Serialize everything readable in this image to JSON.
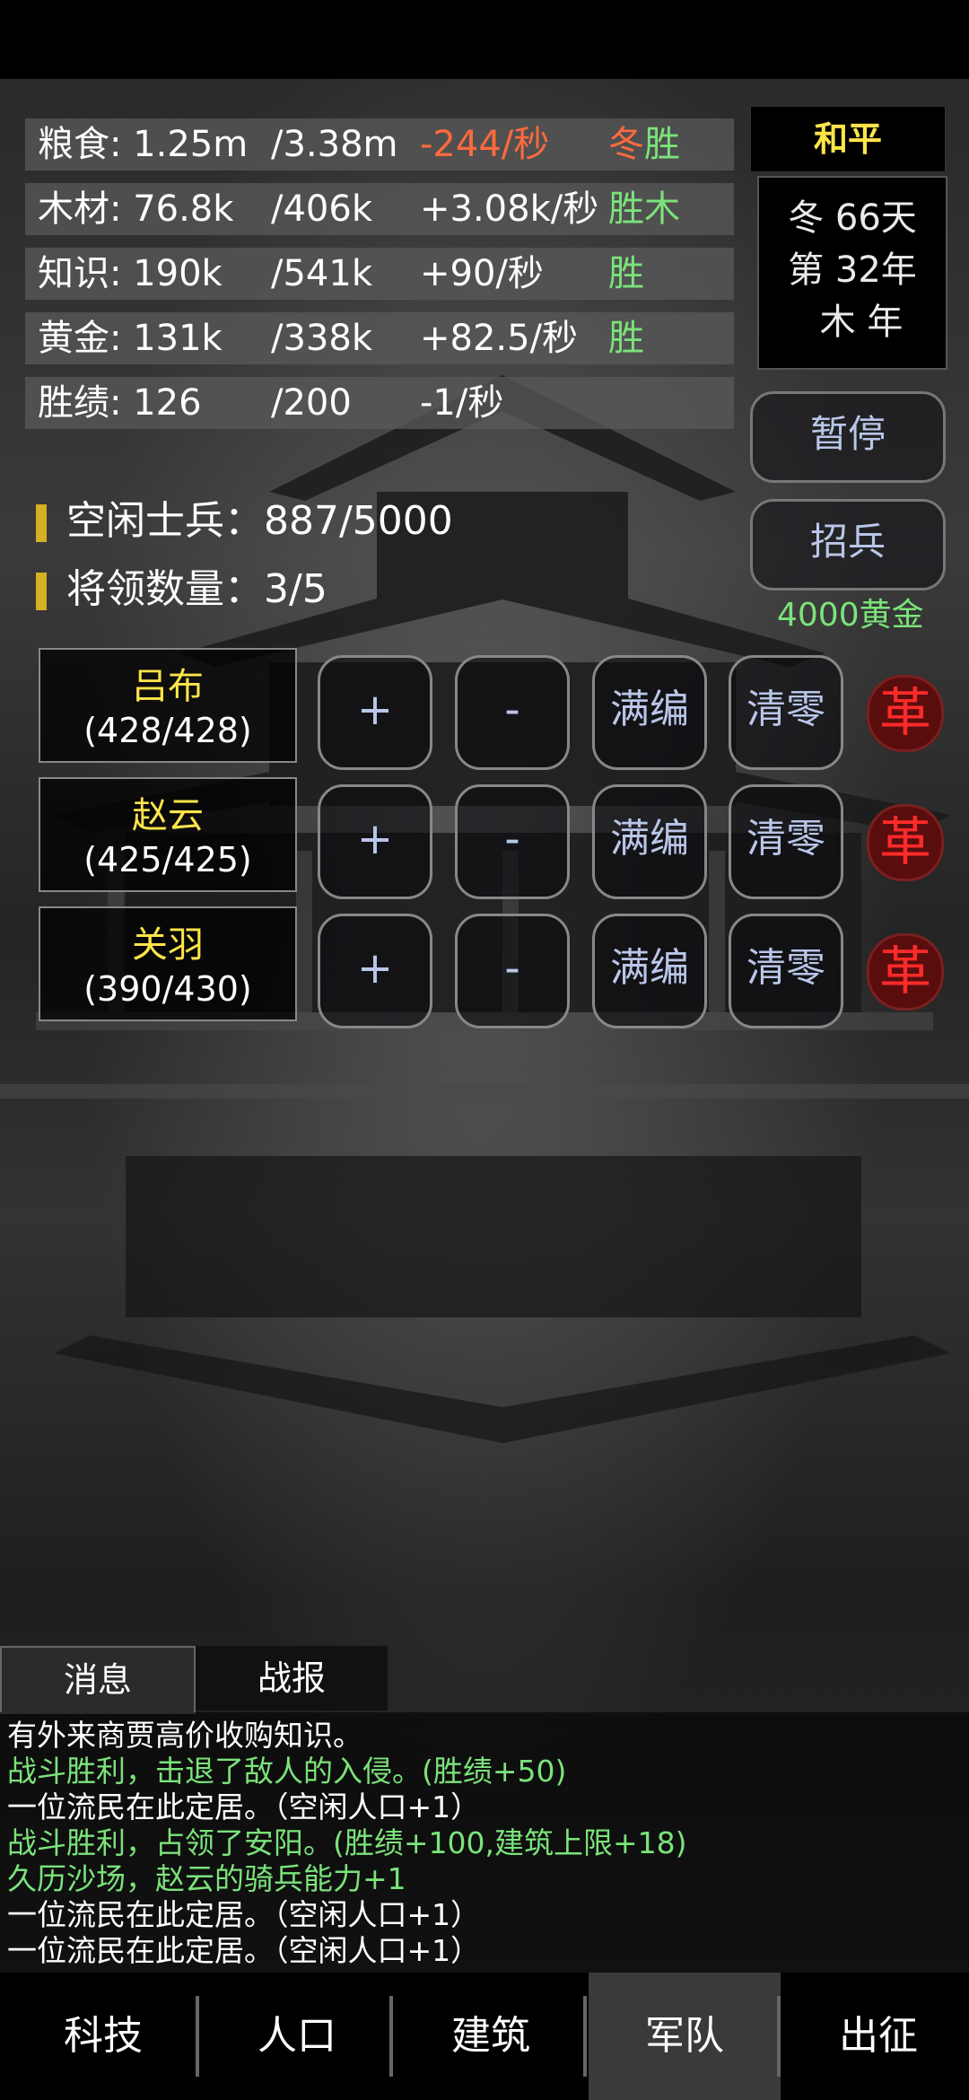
{
  "resources": [
    {
      "name": "粮食: 1.25m",
      "cap": "/3.38m",
      "rate": "-244/秒",
      "tag": "冬胜",
      "rate_color": "#ff6a3d",
      "tag_color": "#ff6a3d",
      "tag2": "",
      "tag2_color": "#7be37b"
    },
    {
      "name": "木材: 76.8k",
      "cap": "/406k",
      "rate": "+3.08k/秒",
      "tag": "胜木",
      "rate_color": "#ffffff",
      "tag_color": "#7be37b"
    },
    {
      "name": "知识: 190k",
      "cap": "/541k",
      "rate": "+90/秒",
      "tag": "胜",
      "rate_color": "#ffffff",
      "tag_color": "#7be37b"
    },
    {
      "name": "黄金: 131k",
      "cap": "/338k",
      "rate": "+82.5/秒",
      "tag": "胜",
      "rate_color": "#ffffff",
      "tag_color": "#7be37b"
    },
    {
      "name": "胜绩: 126",
      "cap": "/200",
      "rate": "-1/秒",
      "tag": "",
      "rate_color": "#ffffff",
      "tag_color": "#7be37b"
    }
  ],
  "status": {
    "peace": "和平",
    "date_line1": "冬 66天",
    "date_line2": "第 32年",
    "date_line3": "木 年"
  },
  "buttons": {
    "pause": "暂停",
    "recruit": "招兵",
    "recruit_cost": "4000黄金"
  },
  "army": {
    "idle_soldiers": "空闲士兵：887/5000",
    "general_count": "将领数量：3/5"
  },
  "generals": [
    {
      "name": "吕布",
      "troops": "(428/428)"
    },
    {
      "name": "赵云",
      "troops": "(425/425)"
    },
    {
      "name": "关羽",
      "troops": "(390/430)"
    }
  ],
  "general_controls": {
    "plus": "+",
    "minus": "-",
    "fill": "满编",
    "clear": "清零",
    "dismiss": "革"
  },
  "log_tabs": {
    "messages": "消息",
    "battle": "战报"
  },
  "log": [
    {
      "text": "有外来商贾高价收购知识。",
      "color": "#ffffff"
    },
    {
      "text": "战斗胜利，击退了敌人的入侵。(胜绩+50)",
      "color": "#7be37b"
    },
    {
      "text": "一位流民在此定居。（空闲人口+1）",
      "color": "#ffffff"
    },
    {
      "text": "战斗胜利，占领了安阳。(胜绩+100,建筑上限+18)",
      "color": "#7be37b"
    },
    {
      "text": "久历沙场，赵云的骑兵能力+1",
      "color": "#7be37b"
    },
    {
      "text": "一位流民在此定居。（空闲人口+1）",
      "color": "#ffffff"
    },
    {
      "text": "一位流民在此定居。（空闲人口+1）",
      "color": "#ffffff"
    }
  ],
  "nav": {
    "tech": "科技",
    "population": "人口",
    "building": "建筑",
    "army": "军队",
    "expedition": "出征"
  }
}
